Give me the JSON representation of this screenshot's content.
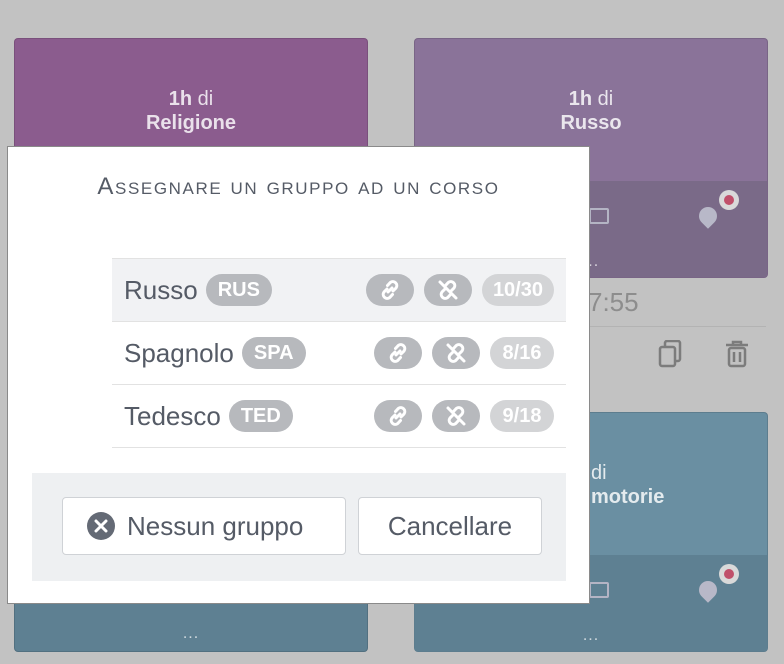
{
  "background": {
    "cards": [
      {
        "hours": "1h",
        "connector": "di",
        "subject": "Religione",
        "color": "#8b5c8e"
      },
      {
        "hours": "1h",
        "connector": "di",
        "subject": "Russo",
        "color": "#8a7399"
      },
      {
        "connector": "di",
        "subject_partial": "motorie",
        "color": "#6a8fa2"
      }
    ],
    "time_partial": "7:55",
    "ellipsis": "..."
  },
  "modal": {
    "title": "Assegnare un gruppo ad un corso",
    "groups": [
      {
        "name": "Russo",
        "code": "RUS",
        "count": "10/30",
        "selected": true
      },
      {
        "name": "Spagnolo",
        "code": "SPA",
        "count": "8/16",
        "selected": false
      },
      {
        "name": "Tedesco",
        "code": "TED",
        "count": "9/18",
        "selected": false
      }
    ],
    "no_group_label": "Nessun gruppo",
    "cancel_label": "Cancellare"
  },
  "colors": {
    "accent_text": "#555b66",
    "badge": "#b7b9bd",
    "count_badge": "#d3d4d6",
    "footer_bg": "#eef0f2"
  },
  "icons": [
    "link-icon",
    "unlink-icon",
    "close-circle-icon",
    "copy-icon",
    "trash-icon",
    "location-pin-icon",
    "monitor-icon"
  ]
}
